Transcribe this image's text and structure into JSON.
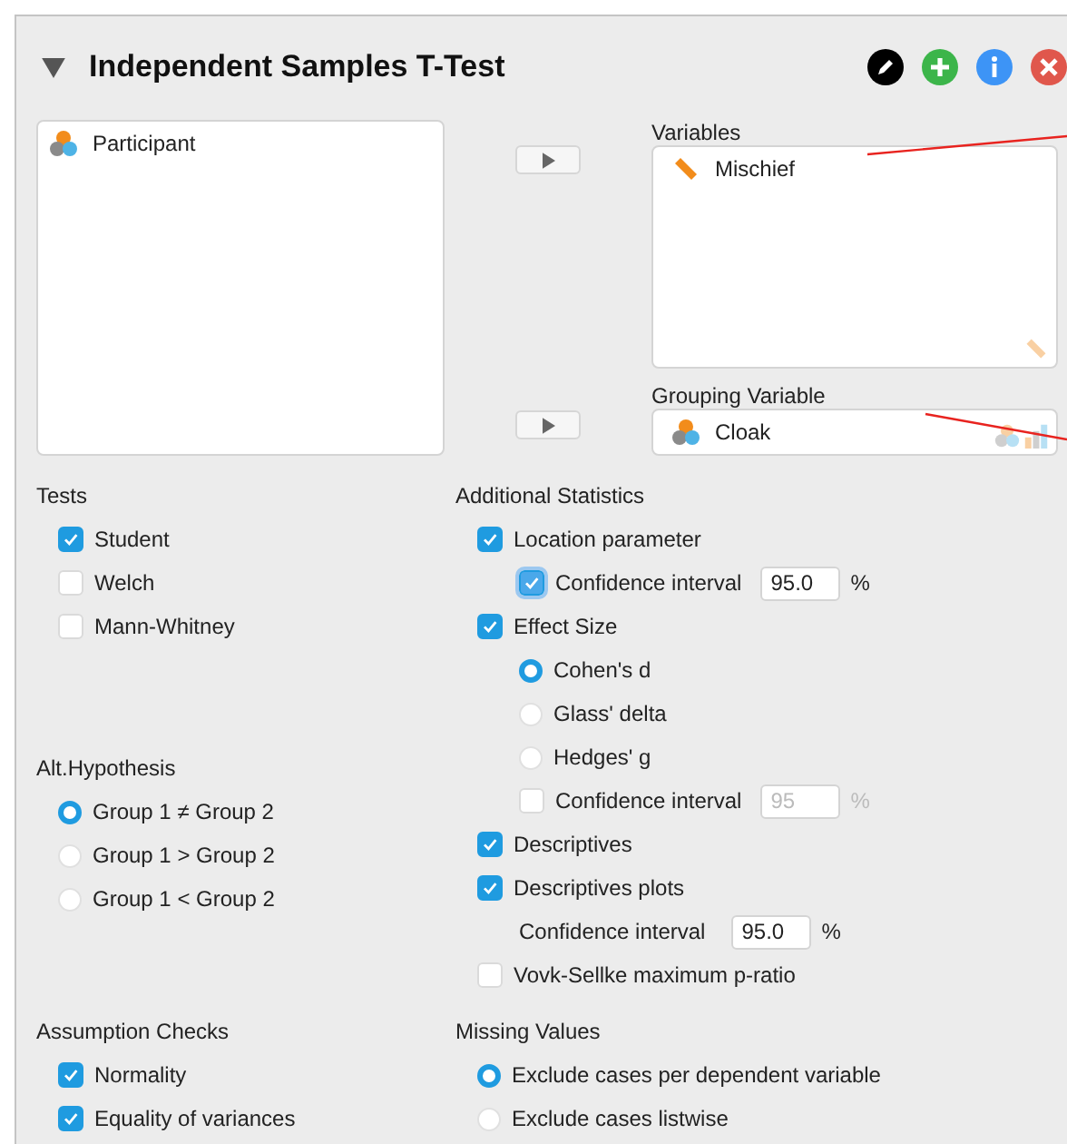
{
  "header": {
    "title": "Independent Samples T-Test",
    "expanded": true
  },
  "available": [
    {
      "name": "Participant"
    }
  ],
  "variables": {
    "label": "Variables",
    "items": [
      {
        "name": "Mischief"
      }
    ]
  },
  "grouping": {
    "label": "Grouping Variable",
    "items": [
      {
        "name": "Cloak"
      }
    ]
  },
  "options": {
    "left": [
      {
        "title": "Tests",
        "items": [
          {
            "kind": "check",
            "label": "Student",
            "checked": true,
            "focused": false
          },
          {
            "kind": "check",
            "label": "Welch",
            "checked": false,
            "focused": false
          },
          {
            "kind": "check",
            "label": "Mann-Whitney",
            "checked": false,
            "focused": false
          }
        ]
      },
      {
        "title": "Alt.Hypothesis",
        "items": [
          {
            "kind": "radio",
            "label": "Group 1 ≠ Group 2",
            "selected": true
          },
          {
            "kind": "radio",
            "label": "Group 1 > Group 2",
            "selected": false
          },
          {
            "kind": "radio",
            "label": "Group 1 < Group 2",
            "selected": false
          }
        ]
      }
    ],
    "right": [
      {
        "title": "Additional Statistics",
        "items": [
          {
            "kind": "check",
            "label": "Location parameter",
            "checked": true,
            "focused": false,
            "children": [
              {
                "kind": "check",
                "label": "Confidence interval",
                "checked": true,
                "focused": true,
                "field": {
                  "value": "95.0",
                  "unit": "%",
                  "disabled": false
                }
              }
            ]
          },
          {
            "kind": "check",
            "label": "Effect Size",
            "checked": true,
            "focused": false,
            "children": [
              {
                "kind": "radio",
                "label": "Cohen's d",
                "selected": true
              },
              {
                "kind": "radio",
                "label": "Glass' delta",
                "selected": false
              },
              {
                "kind": "radio",
                "label": "Hedges' g",
                "selected": false
              },
              {
                "kind": "check",
                "label": "Confidence interval",
                "checked": false,
                "focused": false,
                "field": {
                  "value": "95",
                  "unit": "%",
                  "disabled": true
                }
              }
            ]
          },
          {
            "kind": "check",
            "label": "Descriptives",
            "checked": true,
            "focused": false
          },
          {
            "kind": "check",
            "label": "Descriptives plots",
            "checked": true,
            "focused": false,
            "children": [
              {
                "kind": "field",
                "label": "Confidence interval",
                "field": {
                  "value": "95.0",
                  "unit": "%",
                  "disabled": false
                }
              }
            ]
          },
          {
            "kind": "check",
            "label": "Vovk-Sellke maximum p-ratio",
            "checked": false,
            "focused": false
          }
        ]
      }
    ]
  },
  "bottom_options": {
    "left": [
      {
        "title": "Assumption Checks",
        "items": [
          {
            "kind": "check",
            "label": "Normality",
            "checked": true,
            "focused": false
          },
          {
            "kind": "check",
            "label": "Equality of variances",
            "checked": true,
            "focused": false
          }
        ]
      }
    ],
    "right": [
      {
        "title": "Missing Values",
        "items": [
          {
            "kind": "radio",
            "label": "Exclude cases per dependent variable",
            "selected": true
          },
          {
            "kind": "radio",
            "label": "Exclude cases listwise",
            "selected": false
          }
        ]
      }
    ]
  }
}
